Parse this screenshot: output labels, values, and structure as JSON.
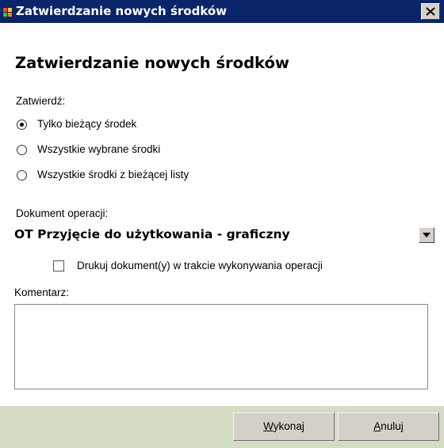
{
  "window": {
    "title": "Zatwierdzanie nowych środków"
  },
  "dialog": {
    "heading": "Zatwierdzanie nowych środków",
    "approve_label": "Zatwierdź:",
    "radio_options": [
      {
        "label": "Tylko bieżący środek",
        "selected": true
      },
      {
        "label": "Wszystkie wybrane środki",
        "selected": false
      },
      {
        "label": "Wszystkie środki z bieżącej listy",
        "selected": false
      }
    ],
    "document_label": "Dokument operacji:",
    "document_value": "OT Przyjęcie do użytkowania - graficzny",
    "print_checkbox": {
      "label": "Drukuj dokument(y) w trakcie wykonywania operacji",
      "checked": false
    },
    "comment_label": "Komentarz:",
    "comment_value": ""
  },
  "buttons": {
    "execute": {
      "access_key": "W",
      "rest": "ykonaj"
    },
    "cancel": {
      "access_key": "A",
      "rest": "nuluj"
    }
  },
  "colors": {
    "titlebar": "#0a246a",
    "footer": "#d4dcc4",
    "button_face": "#d4d0c8"
  }
}
